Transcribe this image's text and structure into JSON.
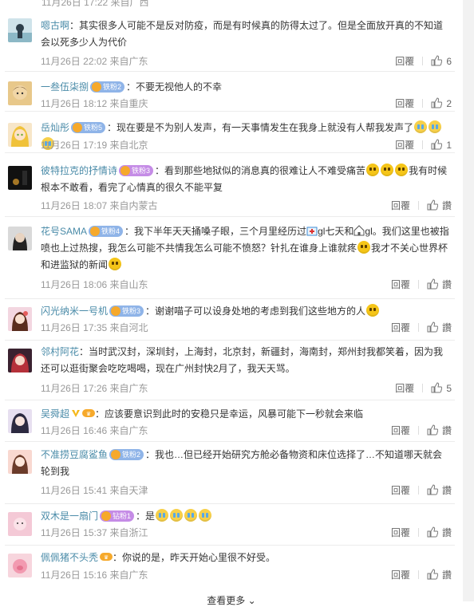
{
  "top": {
    "meta": "11月26日 17:22 来自广西"
  },
  "ui": {
    "reply": "回覆",
    "like_label": "讚",
    "more": "查看更多"
  },
  "comments": [
    {
      "name": "嗯古啊",
      "badge": "",
      "sep": "：",
      "text": "其实很多人可能不是反对防疫，而是有时候真的防得太过了。但是全面放开真的不知道会以死多少人为代价",
      "time": "11月26日 22:02 来自广东",
      "likes": "6",
      "emojis": []
    },
    {
      "name": "一叁伍柒捌",
      "badge": "铁粉2",
      "sep": "：",
      "text": "不要无视他人的不幸",
      "time": "11月26日 18:12 来自重庆",
      "likes": "2",
      "emojis": []
    },
    {
      "name": "岳灿彤",
      "badge": "铁粉5",
      "sep": "：",
      "text": "现在要是不为别人发声，有一天事情发生在我身上就没有人帮我发声了",
      "time": "11月26日 17:19 来自北京",
      "likes": "1",
      "emojis": [
        "cry",
        "cry",
        "cry"
      ]
    },
    {
      "name": "彼特拉克的抒情诗",
      "badge": "铁粉3",
      "sep": "：",
      "text": "看到那些地狱似的消息真的很难让人不难受痛苦",
      "text2": "我有时候根本不敢看，看完了心情真的很久不能平复",
      "time": "11月26日 18:07 来自内蒙古",
      "likes": "讚",
      "emojis": [
        "smile",
        "smile",
        "smile"
      ]
    },
    {
      "name": "花号SAMA",
      "badge": "铁粉4",
      "sep": "：",
      "text": "我下半年天天捅嗓子眼，三个月里经历过",
      "text_a": "gl七天和",
      "text_b": "gl。我们这里也被指喷也上过热搜，我怎么可能不共情我怎么可能不愤怒？针扎在谁身上谁就疼",
      "text_c": "我才不关心世界杯和进监狱的新闻",
      "time": "11月26日 18:06 来自山东",
      "likes": "讚",
      "emojis": []
    },
    {
      "name": "闪光纳米一号机",
      "badge": "铁粉3",
      "sep": "：",
      "text": "谢谢喵子可以设身处地的考虑到我们这些地方的人",
      "time": "11月26日 17:35 来自河北",
      "likes": "讚",
      "emojis": [
        "smile"
      ]
    },
    {
      "name": "邻村阿花",
      "badge": "",
      "sep": "：",
      "text": "当时武汉封，深圳封，上海封，北京封，新疆封，海南封，郑州封我都笑着，因为我还可以逛街聚会吃吃喝喝，现在广州封快2月了，我天天骂。",
      "time": "11月26日 17:26 来自广东",
      "likes": "5",
      "emojis": []
    },
    {
      "name": "吴舜超",
      "badge": "",
      "sep": "：",
      "text": "应该要意识到此时的安稳只是幸运，风暴可能下一秒就会来临",
      "time": "11月26日 16:46 来自广东",
      "likes": "讚",
      "emojis": []
    },
    {
      "name": "不准捞豆腐鲨鱼",
      "badge": "铁粉2",
      "sep": "：",
      "text": "我也…但已经开始研究方舱必备物资和床位选择了…不知道哪天就会轮到我",
      "time": "11月26日 15:41 来自天津",
      "likes": "讚",
      "emojis": []
    },
    {
      "name": "双木是一扇门",
      "badge": "钻粉1",
      "sep": "：",
      "text": "是",
      "time": "11月26日 15:37 来自浙江",
      "likes": "讚",
      "emojis": [
        "cry",
        "cry",
        "cry",
        "cry"
      ]
    },
    {
      "name": "佩佩猪不头秃",
      "badge": "",
      "sep": "：",
      "text": "你说的是，昨天开始心里很不好受。",
      "time": "11月26日 15:16 来自广东",
      "likes": "讚",
      "emojis": []
    }
  ],
  "colors": {
    "username": "#4a8ba8",
    "meta": "#999999",
    "badge_blue": "#8fb4e8",
    "badge_purple": "#c58ce6",
    "crown": "#f6a92b"
  },
  "icons": [
    "thumbs-up-icon",
    "crown-badge-icon",
    "verified-v-icon",
    "emoji-cry-icon",
    "emoji-smile-icon",
    "hospital-icon",
    "home-icon"
  ]
}
